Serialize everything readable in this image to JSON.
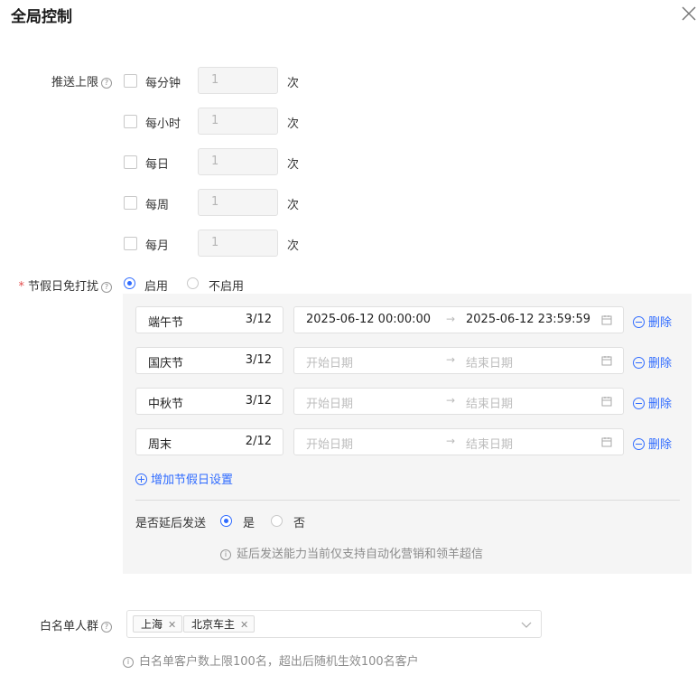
{
  "dialog": {
    "title": "全局控制",
    "close_icon": "close-icon"
  },
  "push_limit": {
    "label": "推送上限",
    "help": "?",
    "rows": [
      {
        "label": "每分钟",
        "value": "1",
        "unit": "次",
        "checked": false
      },
      {
        "label": "每小时",
        "value": "1",
        "unit": "次",
        "checked": false
      },
      {
        "label": "每日",
        "value": "1",
        "unit": "次",
        "checked": false
      },
      {
        "label": "每周",
        "value": "1",
        "unit": "次",
        "checked": false
      },
      {
        "label": "每月",
        "value": "1",
        "unit": "次",
        "checked": false
      }
    ]
  },
  "holiday": {
    "required": "*",
    "label": "节假日免打扰",
    "help": "?",
    "options": [
      {
        "label": "启用",
        "selected": true
      },
      {
        "label": "不启用",
        "selected": false
      }
    ],
    "items": [
      {
        "name": "端午节",
        "count": "3/12",
        "start": "2025-06-12 00:00:00",
        "end": "2025-06-12 23:59:59",
        "start_placeholder": "开始日期",
        "end_placeholder": "结束日期",
        "delete": "删除"
      },
      {
        "name": "国庆节",
        "count": "3/12",
        "start": "",
        "end": "",
        "start_placeholder": "开始日期",
        "end_placeholder": "结束日期",
        "delete": "删除"
      },
      {
        "name": "中秋节",
        "count": "3/12",
        "start": "",
        "end": "",
        "start_placeholder": "开始日期",
        "end_placeholder": "结束日期",
        "delete": "删除"
      },
      {
        "name": "周末",
        "count": "2/12",
        "start": "",
        "end": "",
        "start_placeholder": "开始日期",
        "end_placeholder": "结束日期",
        "delete": "删除"
      }
    ],
    "add_label": "增加节假日设置",
    "delay": {
      "label": "是否延后发送",
      "options": [
        {
          "label": "是",
          "selected": true
        },
        {
          "label": "否",
          "selected": false
        }
      ],
      "note": "延后发送能力当前仅支持自动化营销和领羊超信"
    }
  },
  "whitelist": {
    "label": "白名单人群",
    "help": "?",
    "tags": [
      "上海",
      "北京车主"
    ],
    "note": "白名单客户数上限100名，超出后随机生效100名客户"
  },
  "colors": {
    "accent": "#2f6bff",
    "required": "#e34d4d"
  }
}
